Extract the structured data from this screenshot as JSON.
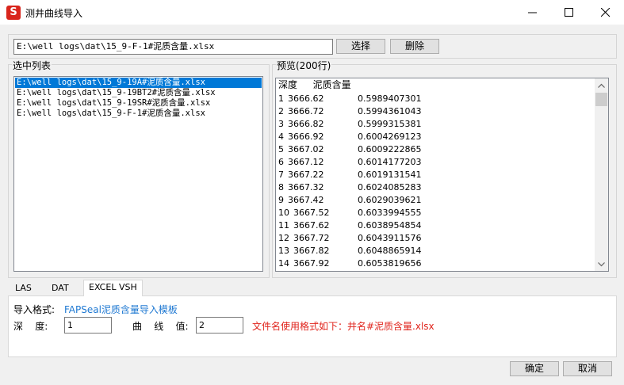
{
  "window": {
    "title": "测井曲线导入",
    "app_icon": "S",
    "colors": {
      "app_icon_bg": "#d9251c",
      "link": "#1e78d2",
      "note": "#e0241c",
      "selection": "#0078d7"
    }
  },
  "path": {
    "value": "E:\\well logs\\dat\\15_9-F-1#泥质含量.xlsx"
  },
  "buttons": {
    "select": "选择",
    "delete": "删除",
    "ok": "确定",
    "cancel": "取消"
  },
  "selected_list": {
    "label": "选中列表",
    "items": [
      "E:\\well logs\\dat\\15_9-19A#泥质含量.xlsx",
      "E:\\well logs\\dat\\15_9-19BT2#泥质含量.xlsx",
      "E:\\well logs\\dat\\15_9-19SR#泥质含量.xlsx",
      "E:\\well logs\\dat\\15_9-F-1#泥质含量.xlsx"
    ],
    "selected_index": 0
  },
  "preview": {
    "label": "预览(200行)",
    "headers": [
      "深度",
      "泥质含量"
    ],
    "rows": [
      [
        "1",
        "3666.62",
        "0.5989407301"
      ],
      [
        "2",
        "3666.72",
        "0.5994361043"
      ],
      [
        "3",
        "3666.82",
        "0.5999315381"
      ],
      [
        "4",
        "3666.92",
        "0.6004269123"
      ],
      [
        "5",
        "3667.02",
        "0.6009222865"
      ],
      [
        "6",
        "3667.12",
        "0.6014177203"
      ],
      [
        "7",
        "3667.22",
        "0.6019131541"
      ],
      [
        "8",
        "3667.32",
        "0.6024085283"
      ],
      [
        "9",
        "3667.42",
        "0.6029039621"
      ],
      [
        "10",
        "3667.52",
        "0.6033994555"
      ],
      [
        "11",
        "3667.62",
        "0.6038954854"
      ],
      [
        "12",
        "3667.72",
        "0.6043911576"
      ],
      [
        "13",
        "3667.82",
        "0.6048865914"
      ],
      [
        "14",
        "3667.92",
        "0.6053819656"
      ]
    ]
  },
  "tabs": [
    {
      "label": "LAS"
    },
    {
      "label": "DAT"
    },
    {
      "label": "EXCEL VSH",
      "active": true
    }
  ],
  "excel_panel": {
    "format_label": "导入格式:",
    "format_link": "FAPSeal泥质含量导入模板",
    "depth_label": "深    度:",
    "depth_value": "1",
    "curve_label": "曲    线    值:",
    "curve_value": "2",
    "filename_note": "文件名使用格式如下：井名#泥质含量.xlsx"
  }
}
